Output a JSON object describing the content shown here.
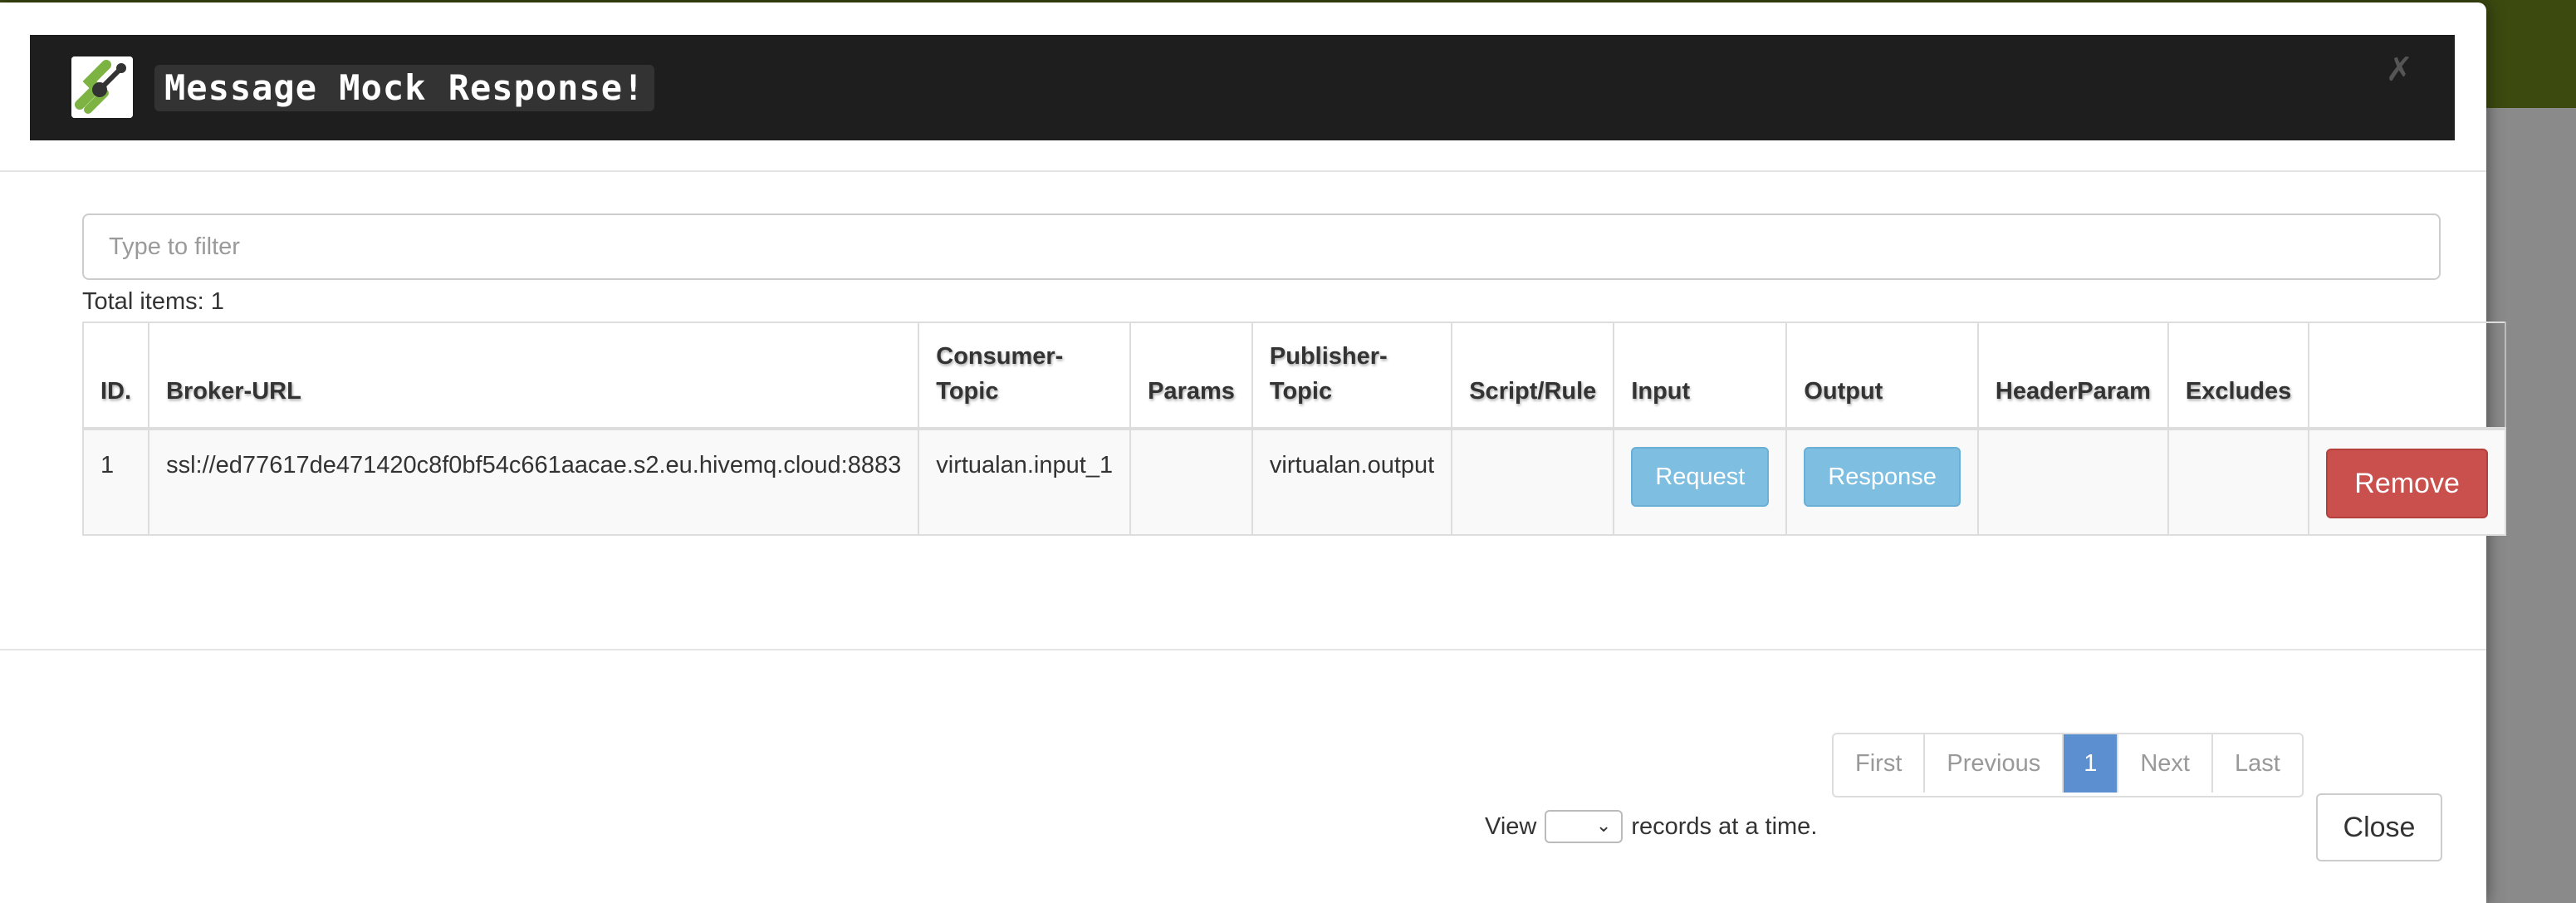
{
  "modal": {
    "title": "Message Mock Response!",
    "close_symbol": "✗",
    "filter_placeholder": "Type to filter",
    "total_items": "Total items: 1"
  },
  "table": {
    "headers": {
      "id": "ID.",
      "broker_url": "Broker-URL",
      "consumer_topic_1": "Consumer-",
      "consumer_topic_2": "Topic",
      "params": "Params",
      "publisher_topic_1": "Publisher-",
      "publisher_topic_2": "Topic",
      "script_rule": "Script/Rule",
      "input": "Input",
      "output": "Output",
      "header_param": "HeaderParam",
      "excludes": "Excludes"
    },
    "rows": [
      {
        "id": "1",
        "broker_url": "ssl://ed77617de471420c8f0bf54c661aacae.s2.eu.hivemq.cloud:8883",
        "consumer_topic": "virtualan.input_1",
        "params": "",
        "publisher_topic": "virtualan.output",
        "script_rule": "",
        "input_label": "Request",
        "output_label": "Response",
        "header_param": "",
        "excludes": "",
        "remove_label": "Remove"
      }
    ]
  },
  "pagination": {
    "first": "First",
    "previous": "Previous",
    "current": "1",
    "next": "Next",
    "last": "Last"
  },
  "view": {
    "prefix": "View",
    "selected": "",
    "suffix": "records at a time."
  },
  "footer": {
    "close_label": "Close"
  },
  "icons": {
    "logo": "virtualan-logo-icon",
    "select_arrow": "chevron-down-icon"
  },
  "colors": {
    "header_bg": "#1e1e1e",
    "navbar_bg": "#3c4a10",
    "info_button": "#7ebee1",
    "danger_button": "#c9504d",
    "active_page": "#5b8fd0",
    "logo_green": "#7cb342"
  }
}
